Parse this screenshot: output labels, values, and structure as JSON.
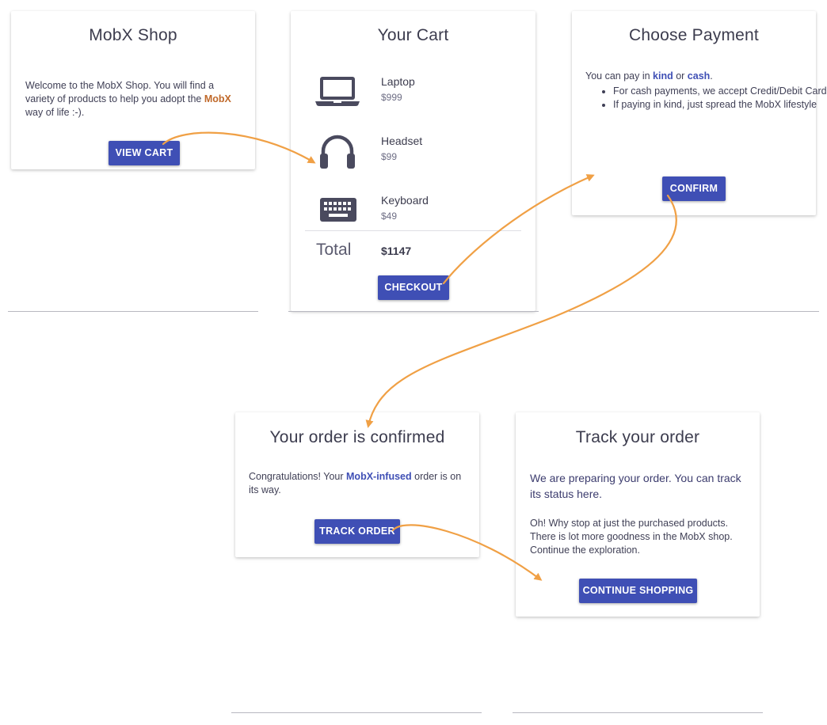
{
  "shop": {
    "title": "MobX Shop",
    "text_before": "Welcome to the MobX Shop. You will find a variety of products to help you adopt the ",
    "text_highlight": "MobX",
    "text_after": " way of life :-).",
    "button": "VIEW CART"
  },
  "cart": {
    "title": "Your Cart",
    "items": [
      {
        "name": "Laptop",
        "price": "$999",
        "icon": "laptop-icon"
      },
      {
        "name": "Headset",
        "price": "$99",
        "icon": "headset-icon"
      },
      {
        "name": "Keyboard",
        "price": "$49",
        "icon": "keyboard-icon"
      }
    ],
    "total_label": "Total",
    "total_value": "$1147",
    "button": "CHECKOUT"
  },
  "payment": {
    "title": "Choose Payment",
    "intro_before": "You can pay in ",
    "intro_kind": "kind",
    "intro_or": " or ",
    "intro_cash": "cash",
    "intro_end": ".",
    "bullets": [
      "For cash payments, we accept Credit/Debit Cards",
      "If paying in kind, just spread the MobX lifestyle"
    ],
    "button": "CONFIRM"
  },
  "confirmed": {
    "title": "Your order is confirmed",
    "text_before": "Congratulations! Your ",
    "text_highlight": "MobX-infused",
    "text_after": " order is on its way.",
    "button": "TRACK ORDER"
  },
  "track": {
    "title": "Track your order",
    "lead": "We are preparing your order. You can track its status here.",
    "text": "Oh! Why stop at just the purchased products. There is lot more goodness in the MobX shop. Continue the exploration.",
    "button": "CONTINUE SHOPPING"
  },
  "colors": {
    "accent": "#3f4fb5",
    "arrow": "#f0a045",
    "icon": "#4a4a5e"
  }
}
